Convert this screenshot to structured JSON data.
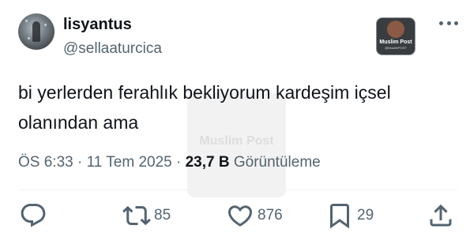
{
  "author": {
    "display_name": "lisyantus",
    "handle": "@sellaaturcica"
  },
  "badge": {
    "title": "Muslim Post",
    "handle": "@MuslimPOST"
  },
  "watermark": {
    "text": "Muslim Post"
  },
  "tweet": {
    "text": "bi yerlerden ferahlık bekliyorum kardeşim içsel olanından ama"
  },
  "meta": {
    "time": "ÖS 6:33",
    "separator": "·",
    "date": "11 Tem 2025",
    "views_count": "23,7 B",
    "views_label": "Görüntüleme"
  },
  "actions": {
    "reply": {
      "icon": "reply-icon"
    },
    "retweet": {
      "icon": "retweet-icon",
      "count": "85"
    },
    "like": {
      "icon": "heart-icon",
      "count": "876"
    },
    "bookmark": {
      "icon": "bookmark-icon",
      "count": "29"
    },
    "share": {
      "icon": "share-icon"
    }
  },
  "colors": {
    "text_primary": "#0f1419",
    "text_secondary": "#536471",
    "divider": "#eff3f4"
  }
}
